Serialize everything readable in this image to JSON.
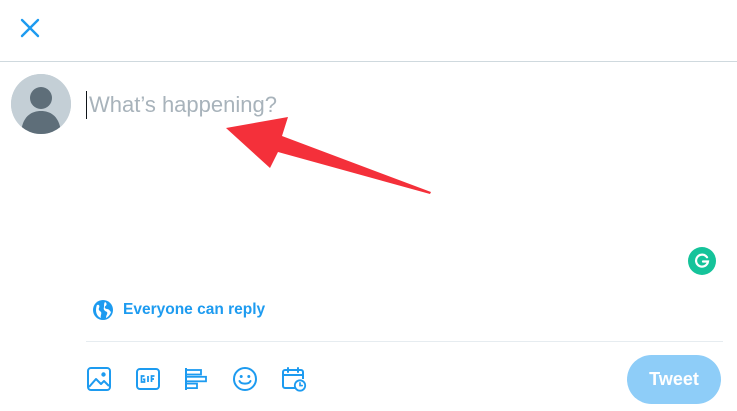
{
  "header": {
    "close_icon": "close-icon"
  },
  "composer": {
    "placeholder": "What’s happening?",
    "avatar_icon": "default-avatar"
  },
  "reply_setting": {
    "label": "Everyone can reply",
    "icon": "globe-icon"
  },
  "toolbar": {
    "icons": [
      "image-icon",
      "gif-icon",
      "poll-icon",
      "emoji-icon",
      "schedule-icon"
    ],
    "tweet_label": "Tweet"
  },
  "extensions": {
    "grammarly_icon": "grammarly-icon"
  },
  "colors": {
    "accent": "#1d9bf0",
    "tweet_button_disabled": "#8ecdf8",
    "placeholder": "#a8b3bb",
    "annotation_arrow": "#f4303a",
    "grammarly": "#15c39a"
  }
}
